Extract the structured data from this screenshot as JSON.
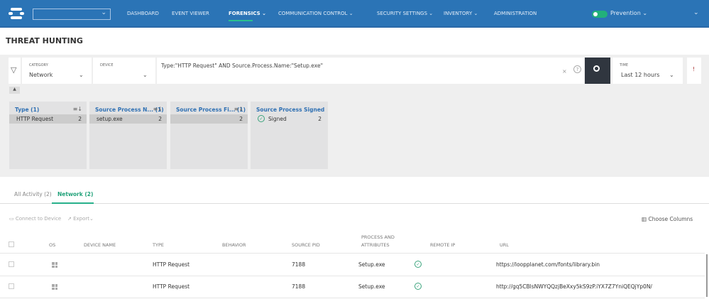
{
  "nav": {
    "items": [
      "DASHBOARD",
      "EVENT VIEWER",
      "FORENSICS",
      "COMMUNICATION CONTROL",
      "SECURITY SETTINGS",
      "INVENTORY",
      "ADMINISTRATION"
    ],
    "mode": "Prevention"
  },
  "page_title": "THREAT HUNTING",
  "search": {
    "category_label": "CATEGORY",
    "category_value": "Network",
    "device_label": "DEVICE",
    "device_value": "",
    "query": "Type:\"HTTP Request\" AND Source.Process.Name:\"Setup.exe\"",
    "time_label": "TIME",
    "time_value": "Last 12 hours"
  },
  "facets": [
    {
      "title": "Type (1)",
      "item": "HTTP Request",
      "count": "2"
    },
    {
      "title": "Source Process N... (1)",
      "item": "setup.exe",
      "count": "2"
    },
    {
      "title": "Source Process Fi... (1)",
      "item": "",
      "count": "2"
    },
    {
      "title": "Source Process Signed",
      "item": "Signed",
      "count": "2"
    }
  ],
  "tabs": [
    "All Activity (2)",
    "Network (2)"
  ],
  "toolbar": {
    "connect": "Connect to Device",
    "export": "Export",
    "choose_columns": "Choose Columns"
  },
  "table": {
    "headers": [
      "OS",
      "DEVICE NAME",
      "TYPE",
      "BEHAVIOR",
      "SOURCE PID",
      "PROCESS AND",
      "ATTRIBUTES",
      "REMOTE IP",
      "URL"
    ],
    "rows": [
      {
        "type": "HTTP Request",
        "pid": "7188",
        "process": "Setup.exe",
        "url": "https://loopplanet.com/fonts/library.bin"
      },
      {
        "type": "HTTP Request",
        "pid": "7188",
        "process": "Setup.exe",
        "url": "http://gq5CBlsNWYQQzjBeXxy5kS9zP.iYX7Z7YniQEQjYp0N/"
      }
    ]
  }
}
